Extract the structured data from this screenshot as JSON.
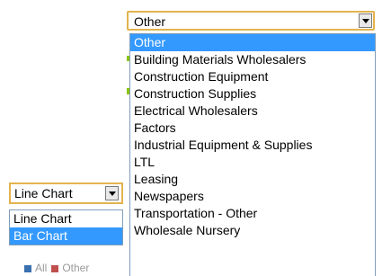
{
  "category_select": {
    "selected": "Other",
    "options": [
      "Other",
      "Building Materials Wholesalers",
      "Construction Equipment",
      "Construction Supplies",
      "Electrical Wholesalers",
      "Factors",
      "Industrial Equipment & Supplies",
      "LTL",
      "Leasing",
      "Newspapers",
      "Transportation - Other",
      "Wholesale Nursery"
    ],
    "highlighted": "Other"
  },
  "chart_type_select": {
    "selected": "Line Chart",
    "options": [
      "Line Chart",
      "Bar Chart"
    ],
    "highlighted": "Bar Chart"
  },
  "legend": {
    "items": [
      {
        "label": "All",
        "color": "#3a6fb0"
      },
      {
        "label": "Other",
        "color": "#c0504d"
      }
    ]
  },
  "colors": {
    "select_border": "#e3b34d",
    "highlight": "#3399ff",
    "list_border": "#7f9db9",
    "series_green": "#8ac400"
  }
}
